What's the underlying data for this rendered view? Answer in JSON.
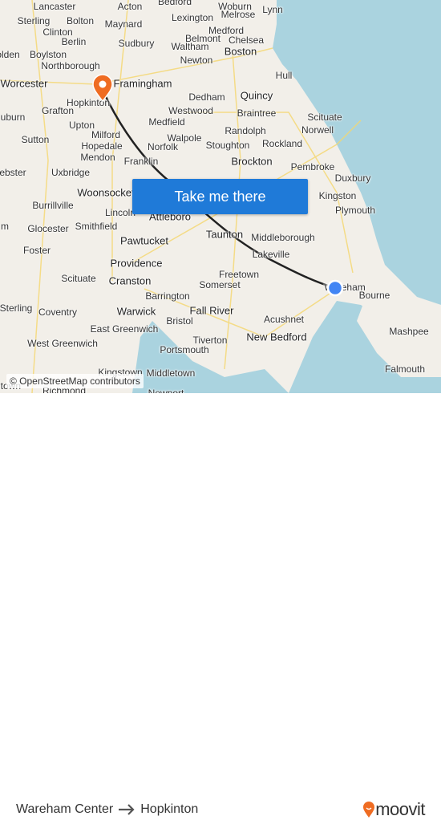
{
  "map": {
    "towns": [
      "Lancaster",
      "Acton",
      "Bedford",
      "Woburn",
      "Lynn",
      "Sterling",
      "Bolton",
      "Maynard",
      "Lexington",
      "Melrose",
      "Clinton",
      "Medford",
      "Berlin",
      "Sudbury",
      "Belmont",
      "Chelsea",
      "olden",
      "Boylston",
      "Waltham",
      "Boston",
      "Northborough",
      "Newton",
      "Worcester",
      "Framingham",
      "Hull",
      "Hopkinton",
      "Quincy",
      "Grafton",
      "Dedham",
      "Westwood",
      "uburn",
      "Upton",
      "Medfield",
      "Braintree",
      "Scituate",
      "Norwell",
      "Sutton",
      "Milford",
      "Randolph",
      "Hopedale",
      "Walpole",
      "Norfolk",
      "Stoughton",
      "Rockland",
      "Mendon",
      "Franklin",
      "Brockton",
      "Pembroke",
      "ebster",
      "Uxbridge",
      "Duxbury",
      "Woonsocket",
      "Kingston",
      "Burrillville",
      "Lincoln",
      "Attleboro",
      "Plymouth",
      "Smithfield",
      "Glocester",
      "Taunton",
      "Middleborough",
      "m",
      "Pawtucket",
      "Foster",
      "Lakeville",
      "Providence",
      "Scituate",
      "Cranston",
      "Freetown",
      "Somerset",
      "Wareham",
      "Bourne",
      "Barrington",
      "Sterling",
      "Coventry",
      "Warwick",
      "Fall River",
      "East Greenwich",
      "Bristol",
      "Acushnet",
      "West Greenwich",
      "Tiverton",
      "New Bedford",
      "Mashpee",
      "Portsmouth",
      "Kingstown",
      "Middletown",
      "Falmouth",
      "Richmond",
      "Newport",
      "ntown"
    ],
    "button_label": "Take me there",
    "attribution": "© OpenStreetMap contributors",
    "colors": {
      "land": "#f2efe9",
      "water": "#aad3df",
      "route": "#222222",
      "origin": "#4285f4",
      "destination": "#ef6c22",
      "button": "#1f7ad8"
    },
    "origin_marker": "origin-dot",
    "destination_marker": "destination-pin-icon"
  },
  "footer": {
    "origin": "Wareham Center",
    "arrow_icon": "arrow-right-icon",
    "destination": "Hopkinton",
    "logo_text": "moovit"
  }
}
